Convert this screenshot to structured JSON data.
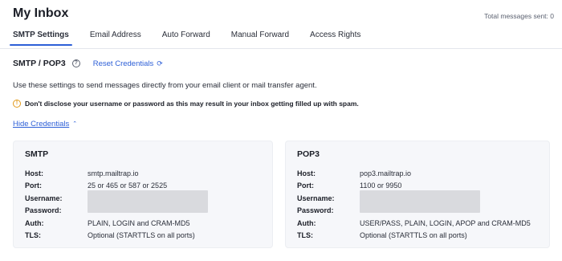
{
  "header": {
    "title": "My Inbox",
    "total_sent": "Total messages sent: 0"
  },
  "tabs": [
    {
      "label": "SMTP Settings",
      "active": true
    },
    {
      "label": "Email Address",
      "active": false
    },
    {
      "label": "Auto Forward",
      "active": false
    },
    {
      "label": "Manual Forward",
      "active": false
    },
    {
      "label": "Access Rights",
      "active": false
    }
  ],
  "section": {
    "title": "SMTP / POP3",
    "help_icon": "help-circle-icon",
    "reset_label": "Reset Credentials",
    "reset_icon": "refresh-icon"
  },
  "description": "Use these settings to send messages directly from your email client or mail transfer agent.",
  "warning": {
    "icon": "warning-icon",
    "text": "Don't disclose your username or password as this may result in your inbox getting filled up with spam."
  },
  "hide_credentials": "Hide Credentials",
  "smtp": {
    "title": "SMTP",
    "labels": {
      "host": "Host:",
      "port": "Port:",
      "username": "Username:",
      "password": "Password:",
      "auth": "Auth:",
      "tls": "TLS:"
    },
    "host": "smtp.mailtrap.io",
    "port": "25 or 465 or 587 or 2525",
    "auth": "PLAIN, LOGIN and CRAM-MD5",
    "tls": "Optional (STARTTLS on all ports)"
  },
  "pop3": {
    "title": "POP3",
    "labels": {
      "host": "Host:",
      "port": "Port:",
      "username": "Username:",
      "password": "Password:",
      "auth": "Auth:",
      "tls": "TLS:"
    },
    "host": "pop3.mailtrap.io",
    "port": "1100 or 9950",
    "auth": "USER/PASS, PLAIN, LOGIN, APOP and CRAM-MD5",
    "tls": "Optional (STARTTLS on all ports)"
  },
  "colors": {
    "accent": "#2d5fd7",
    "warning": "#e29a1b",
    "card_bg": "#f6f7fa"
  }
}
